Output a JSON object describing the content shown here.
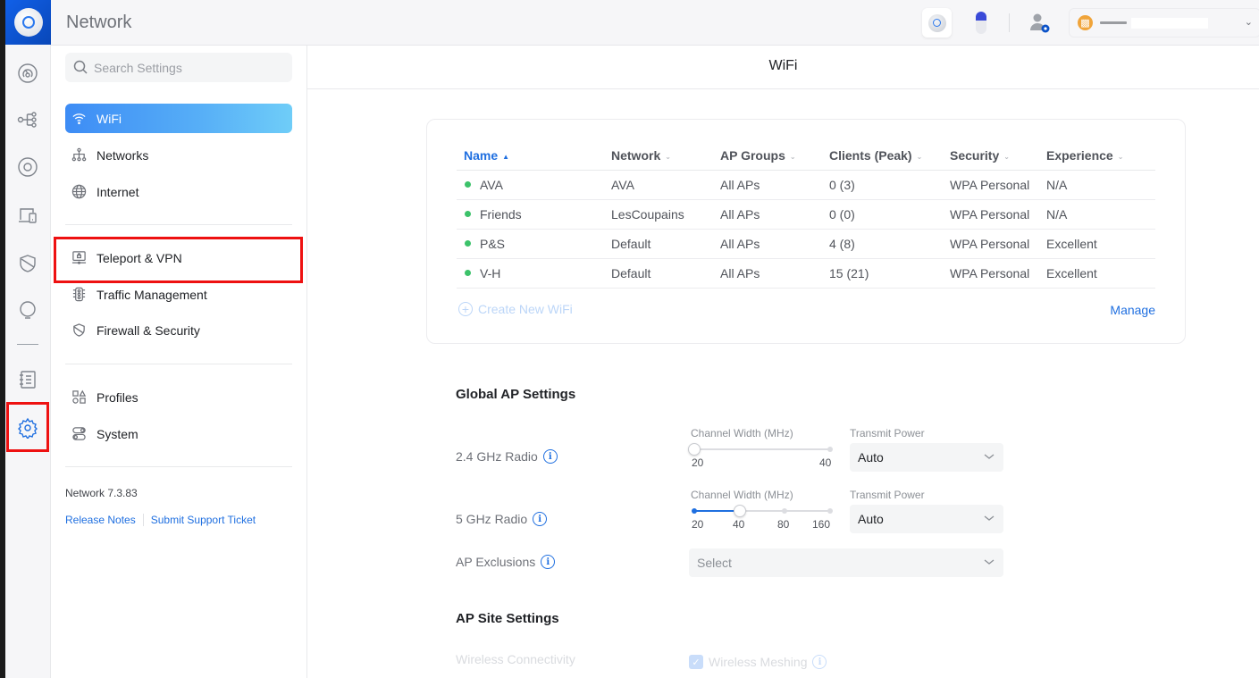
{
  "app": {
    "title": "Network"
  },
  "topbar": {
    "device_icons": [
      "access-point-icon",
      "camera-icon"
    ],
    "admin_icon": "admin-settings-icon",
    "site_selector": {
      "icon": "globe-icon",
      "value_redacted": true
    }
  },
  "rail": {
    "items": [
      {
        "name": "dashboard",
        "icon": "dashboard-icon"
      },
      {
        "name": "topology",
        "icon": "topology-icon"
      },
      {
        "name": "devices",
        "icon": "devices-icon"
      },
      {
        "name": "clients",
        "icon": "clients-icon"
      },
      {
        "name": "security",
        "icon": "shield-icon"
      },
      {
        "name": "insights",
        "icon": "bulb-icon"
      },
      {
        "name": "logs",
        "icon": "notebook-icon"
      },
      {
        "name": "settings",
        "icon": "gear-icon",
        "active": true,
        "highlighted": true
      }
    ]
  },
  "sidebar": {
    "search_placeholder": "Search Settings",
    "items": [
      {
        "label": "WiFi",
        "icon": "wifi-icon",
        "active": true
      },
      {
        "label": "Networks",
        "icon": "networks-icon"
      },
      {
        "label": "Internet",
        "icon": "globe-icon"
      },
      {
        "label": "Teleport & VPN",
        "icon": "vpn-icon",
        "highlighted": true
      },
      {
        "label": "Traffic Management",
        "icon": "traffic-light-icon"
      },
      {
        "label": "Firewall & Security",
        "icon": "shield-icon"
      },
      {
        "label": "Profiles",
        "icon": "profiles-icon"
      },
      {
        "label": "System",
        "icon": "toggles-icon"
      }
    ],
    "version": "Network 7.3.83",
    "release_notes": "Release Notes",
    "support_ticket": "Submit Support Ticket"
  },
  "main": {
    "title": "WiFi",
    "wifi_table": {
      "columns": [
        {
          "label": "Name",
          "sort": "asc"
        },
        {
          "label": "Network"
        },
        {
          "label": "AP Groups"
        },
        {
          "label": "Clients (Peak)"
        },
        {
          "label": "Security"
        },
        {
          "label": "Experience"
        }
      ],
      "rows": [
        {
          "name": "AVA",
          "network": "AVA",
          "ap_groups": "All APs",
          "clients": "0 (3)",
          "security": "WPA Personal",
          "experience": "N/A",
          "status": "active"
        },
        {
          "name": "Friends",
          "network": "LesCoupains",
          "ap_groups": "All APs",
          "clients": "0 (0)",
          "security": "WPA Personal",
          "experience": "N/A",
          "status": "active"
        },
        {
          "name": "P&S",
          "network": "Default",
          "ap_groups": "All APs",
          "clients": "4 (8)",
          "security": "WPA Personal",
          "experience": "Excellent",
          "status": "active"
        },
        {
          "name": "V-H",
          "network": "Default",
          "ap_groups": "All APs",
          "clients": "15 (21)",
          "security": "WPA Personal",
          "experience": "Excellent",
          "status": "active"
        }
      ],
      "create_label": "Create New WiFi",
      "manage_label": "Manage"
    },
    "global_ap": {
      "heading": "Global AP Settings",
      "radio_24": {
        "label": "2.4 GHz Radio",
        "channel_width_label": "Channel Width (MHz)",
        "channel_width_options": [
          "20",
          "40"
        ],
        "channel_width_value": "20",
        "transmit_power_label": "Transmit Power",
        "transmit_power_value": "Auto"
      },
      "radio_5": {
        "label": "5 GHz Radio",
        "channel_width_label": "Channel Width (MHz)",
        "channel_width_options": [
          "20",
          "40",
          "80",
          "160"
        ],
        "channel_width_value": "40",
        "transmit_power_label": "Transmit Power",
        "transmit_power_value": "Auto"
      },
      "ap_exclusions": {
        "label": "AP Exclusions",
        "placeholder": "Select"
      }
    },
    "ap_site": {
      "heading": "AP Site Settings",
      "wireless_connectivity_label": "Wireless Connectivity",
      "wireless_meshing_label": "Wireless Meshing",
      "wireless_meshing_checked": true
    }
  },
  "colors": {
    "accent": "#1f6fe0",
    "status_green": "#3cc26a",
    "highlight_red": "#ee1111",
    "site_globe": "#f0a43a"
  }
}
